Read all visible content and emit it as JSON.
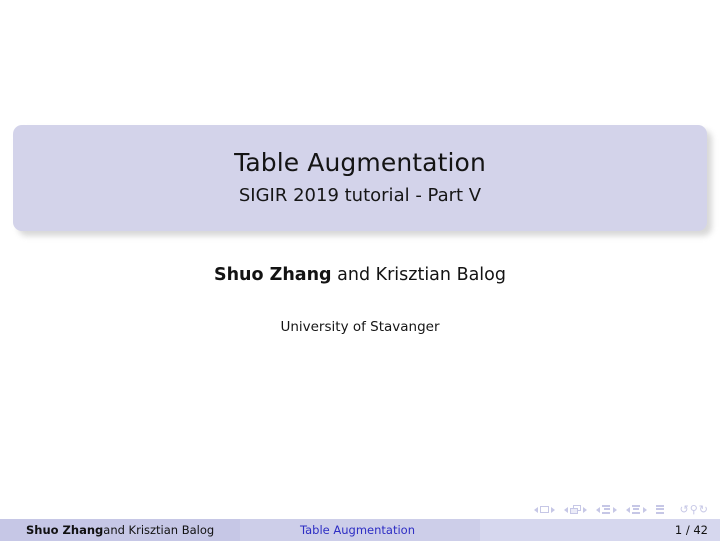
{
  "slide": {
    "title": "Table Augmentation",
    "subtitle": "SIGIR 2019 tutorial - Part V",
    "authors_bold": "Shuo Zhang",
    "authors_rest": " and Krisztian Balog",
    "institute": "University of Stavanger",
    "title_box_color": "#d3d3ea",
    "background_color": "#ffffff"
  },
  "footline": {
    "author_bold": "Shuo Zhang",
    "author_rest": " and Krisztian Balog",
    "title": "Table Augmentation",
    "page": "1 / 42",
    "author_cell_color": "#c6c7e6",
    "title_cell_color": "#cdcee9",
    "page_cell_color": "#d6d7ee",
    "link_color": "#2d2dc4"
  },
  "navigation_symbols": {
    "color": "#c6c7e6",
    "items": [
      "slide-navigation-icon",
      "frame-navigation-icon",
      "subsection-navigation-icon",
      "section-navigation-icon",
      "presentation-navigation-icon",
      "back-navigation-icon",
      "search-navigation-icon",
      "forward-navigation-icon"
    ]
  }
}
